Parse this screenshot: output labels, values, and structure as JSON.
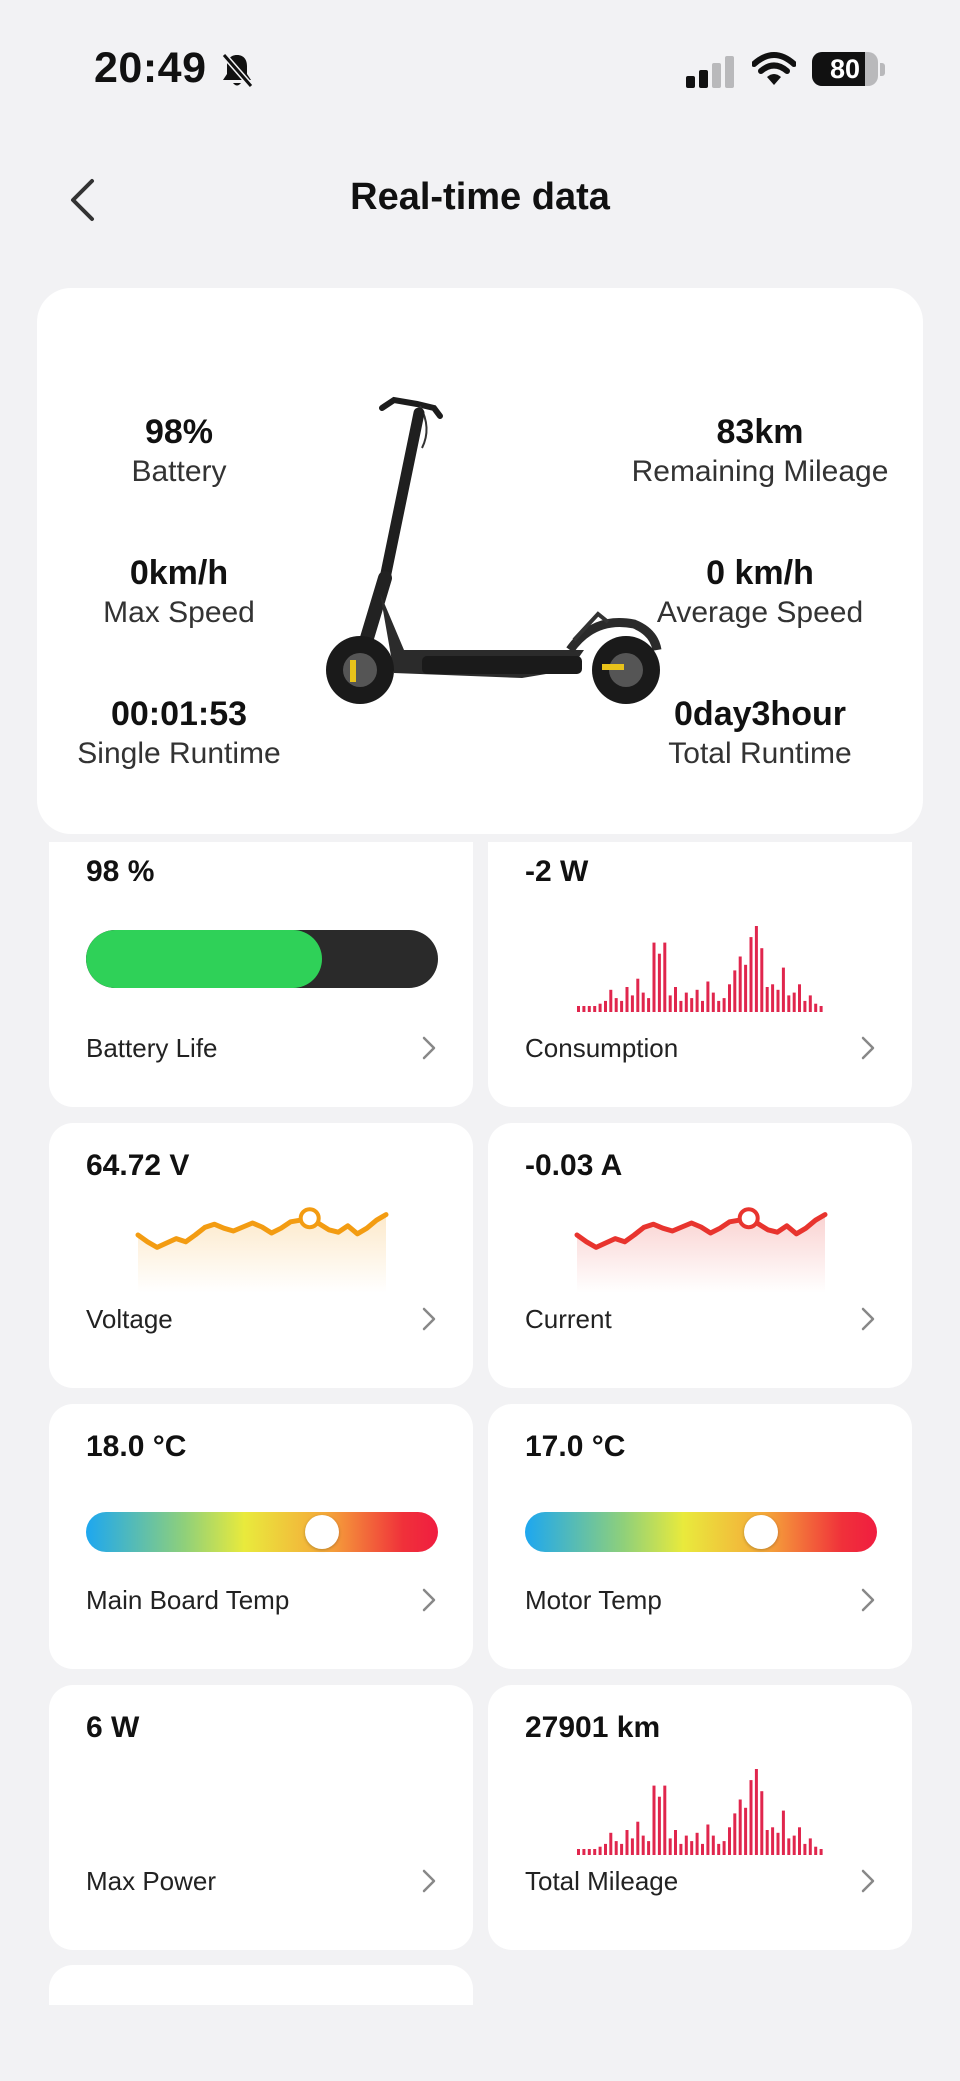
{
  "status_bar": {
    "time": "20:49",
    "battery_level": "80",
    "battery_fraction": 0.8,
    "icons": [
      "bell-slash-icon",
      "cellular-signal-icon",
      "wifi-icon",
      "battery-icon"
    ]
  },
  "nav": {
    "title": "Real-time data",
    "back_icon": "chevron-left-icon"
  },
  "summary": {
    "battery_value": "98%",
    "battery_label": "Battery",
    "max_speed_value": "0km/h",
    "max_speed_label": "Max Speed",
    "single_runtime_value": "00:01:53",
    "single_runtime_label": "Single Runtime",
    "remaining_mileage_value": "83km",
    "remaining_mileage_label": "Remaining Mileage",
    "average_speed_value": "0 km/h",
    "average_speed_label": "Average Speed",
    "total_runtime_value": "0day3hour",
    "total_runtime_label": "Total Runtime"
  },
  "metrics": {
    "battery_life": {
      "value": "98 %",
      "label": "Battery Life",
      "fill_fraction": 0.67,
      "color": "#2fd158"
    },
    "consumption": {
      "value": "-2 W",
      "label": "Consumption",
      "color": "#e0264d"
    },
    "voltage": {
      "value": "64.72 V",
      "label": "Voltage",
      "color": "#f39c12"
    },
    "current": {
      "value": "-0.03 A",
      "label": "Current",
      "color": "#e8342e"
    },
    "main_board_temp": {
      "value": "18.0 °C",
      "label": "Main Board Temp",
      "knob_fraction": 0.67
    },
    "motor_temp": {
      "value": "17.0 °C",
      "label": "Motor Temp",
      "knob_fraction": 0.67
    },
    "max_power": {
      "value": "6 W",
      "label": "Max Power"
    },
    "total_mileage": {
      "value": "27901 km",
      "label": "Total Mileage",
      "color": "#e0264d"
    }
  },
  "spark_bars": [
    2,
    2,
    2,
    2,
    3,
    4,
    8,
    5,
    4,
    9,
    6,
    12,
    7,
    5,
    25,
    21,
    25,
    6,
    9,
    4,
    7,
    5,
    8,
    4,
    11,
    7,
    4,
    5,
    10,
    15,
    20,
    17,
    27,
    31,
    23,
    9,
    10,
    8,
    16,
    6,
    7,
    10,
    4,
    6,
    3,
    2
  ],
  "wave_points": [
    0.55,
    0.72,
    0.86,
    0.75,
    0.64,
    0.72,
    0.55,
    0.36,
    0.28,
    0.38,
    0.45,
    0.35,
    0.25,
    0.35,
    0.5,
    0.38,
    0.22,
    0.18,
    0.13,
    0.27,
    0.42,
    0.48,
    0.32,
    0.52,
    0.38,
    0.18,
    0.04
  ]
}
